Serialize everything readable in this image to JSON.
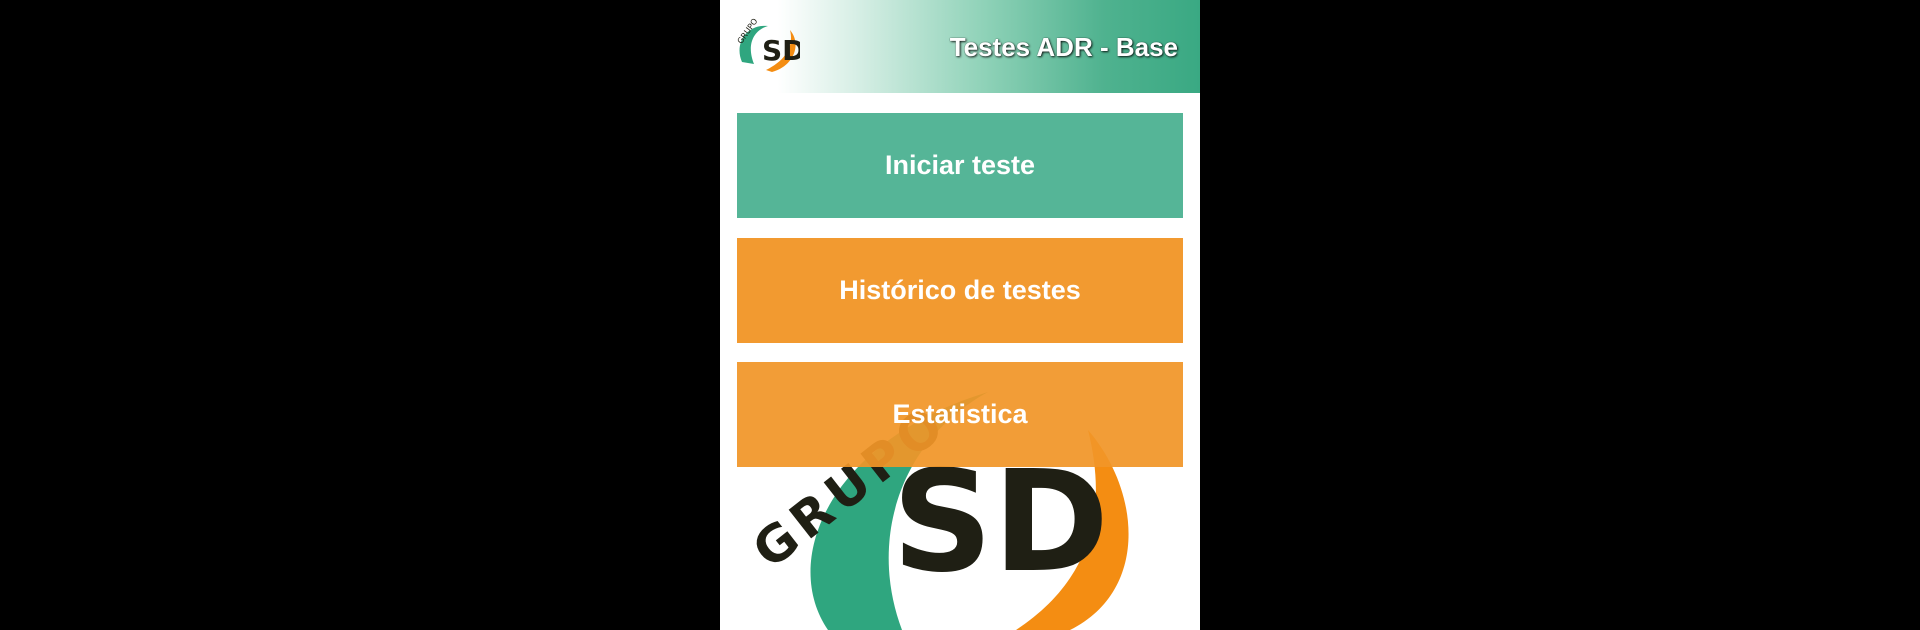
{
  "app_bar": {
    "title": "Testes ADR - Base",
    "logo_text_small": "GRUPO",
    "logo_letters_small": "SD"
  },
  "menu": {
    "start_test_label": "Iniciar teste",
    "history_label": "Histórico de testes",
    "statistics_label": "Estatistica"
  },
  "watermark": {
    "word": "GRUPO",
    "letters": "SD"
  },
  "colors": {
    "green": "#55b597",
    "orange": "#f29a30",
    "logo_orange": "#f48d12",
    "logo_green": "#2fa67f",
    "logo_dark": "#1f1f14"
  }
}
